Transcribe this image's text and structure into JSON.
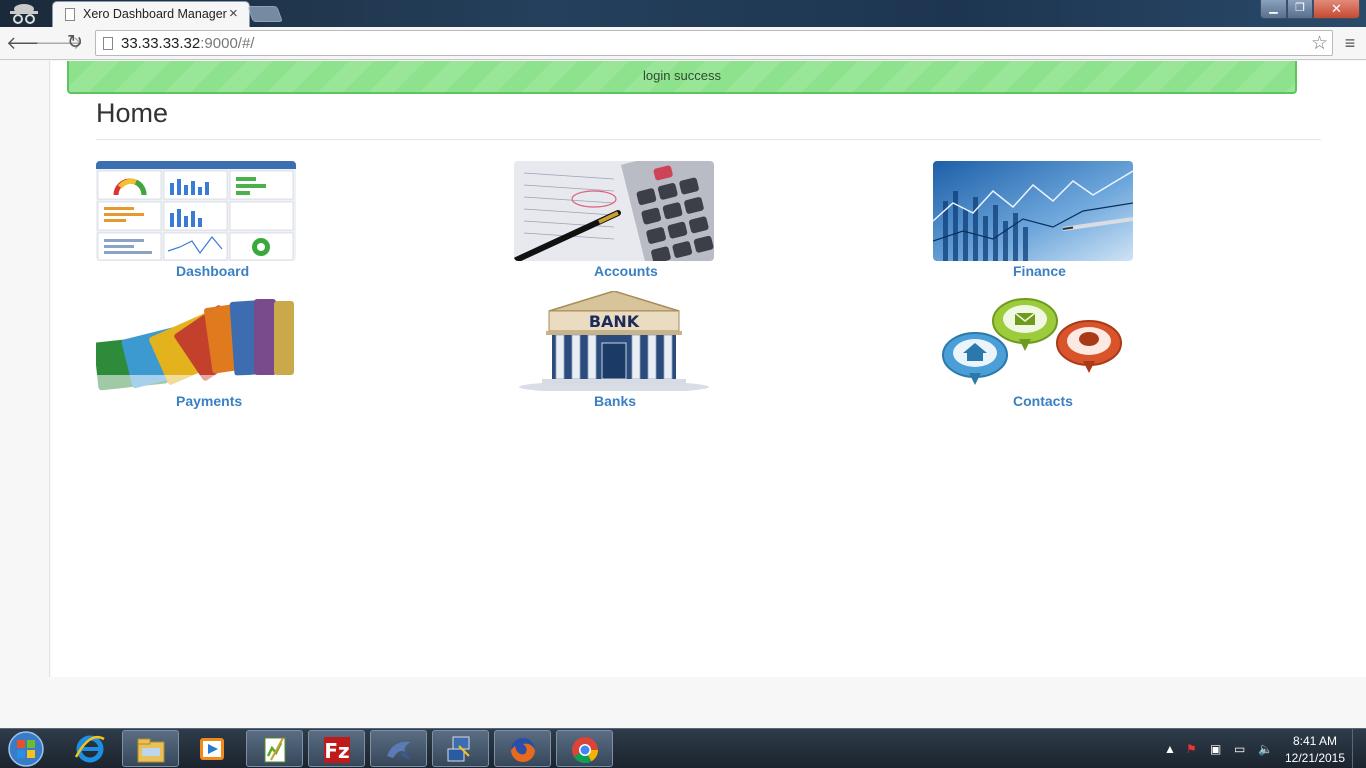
{
  "browser": {
    "tab_title": "Xero Dashboard Manager",
    "tab_close": "×",
    "url_host": "33.33.33.32",
    "url_rest": ":9000/#/"
  },
  "alert": {
    "message": "login success"
  },
  "page": {
    "title": "Home"
  },
  "tiles": [
    {
      "label": "Dashboard",
      "icon": "dashboard-screenshot-image"
    },
    {
      "label": "Accounts",
      "icon": "calculator-pen-image"
    },
    {
      "label": "Finance",
      "icon": "finance-chart-image"
    },
    {
      "label": "Payments",
      "icon": "credit-cards-image"
    },
    {
      "label": "Banks",
      "icon": "bank-building-image"
    },
    {
      "label": "Contacts",
      "icon": "contact-pins-image"
    }
  ],
  "bank_sign": "BANK",
  "taskbar": {
    "time": "8:41 AM",
    "date": "12/21/2015"
  },
  "colors": {
    "link": "#3a80c2",
    "alert_bg": "#8ee28e",
    "alert_border": "#5fc35f"
  }
}
